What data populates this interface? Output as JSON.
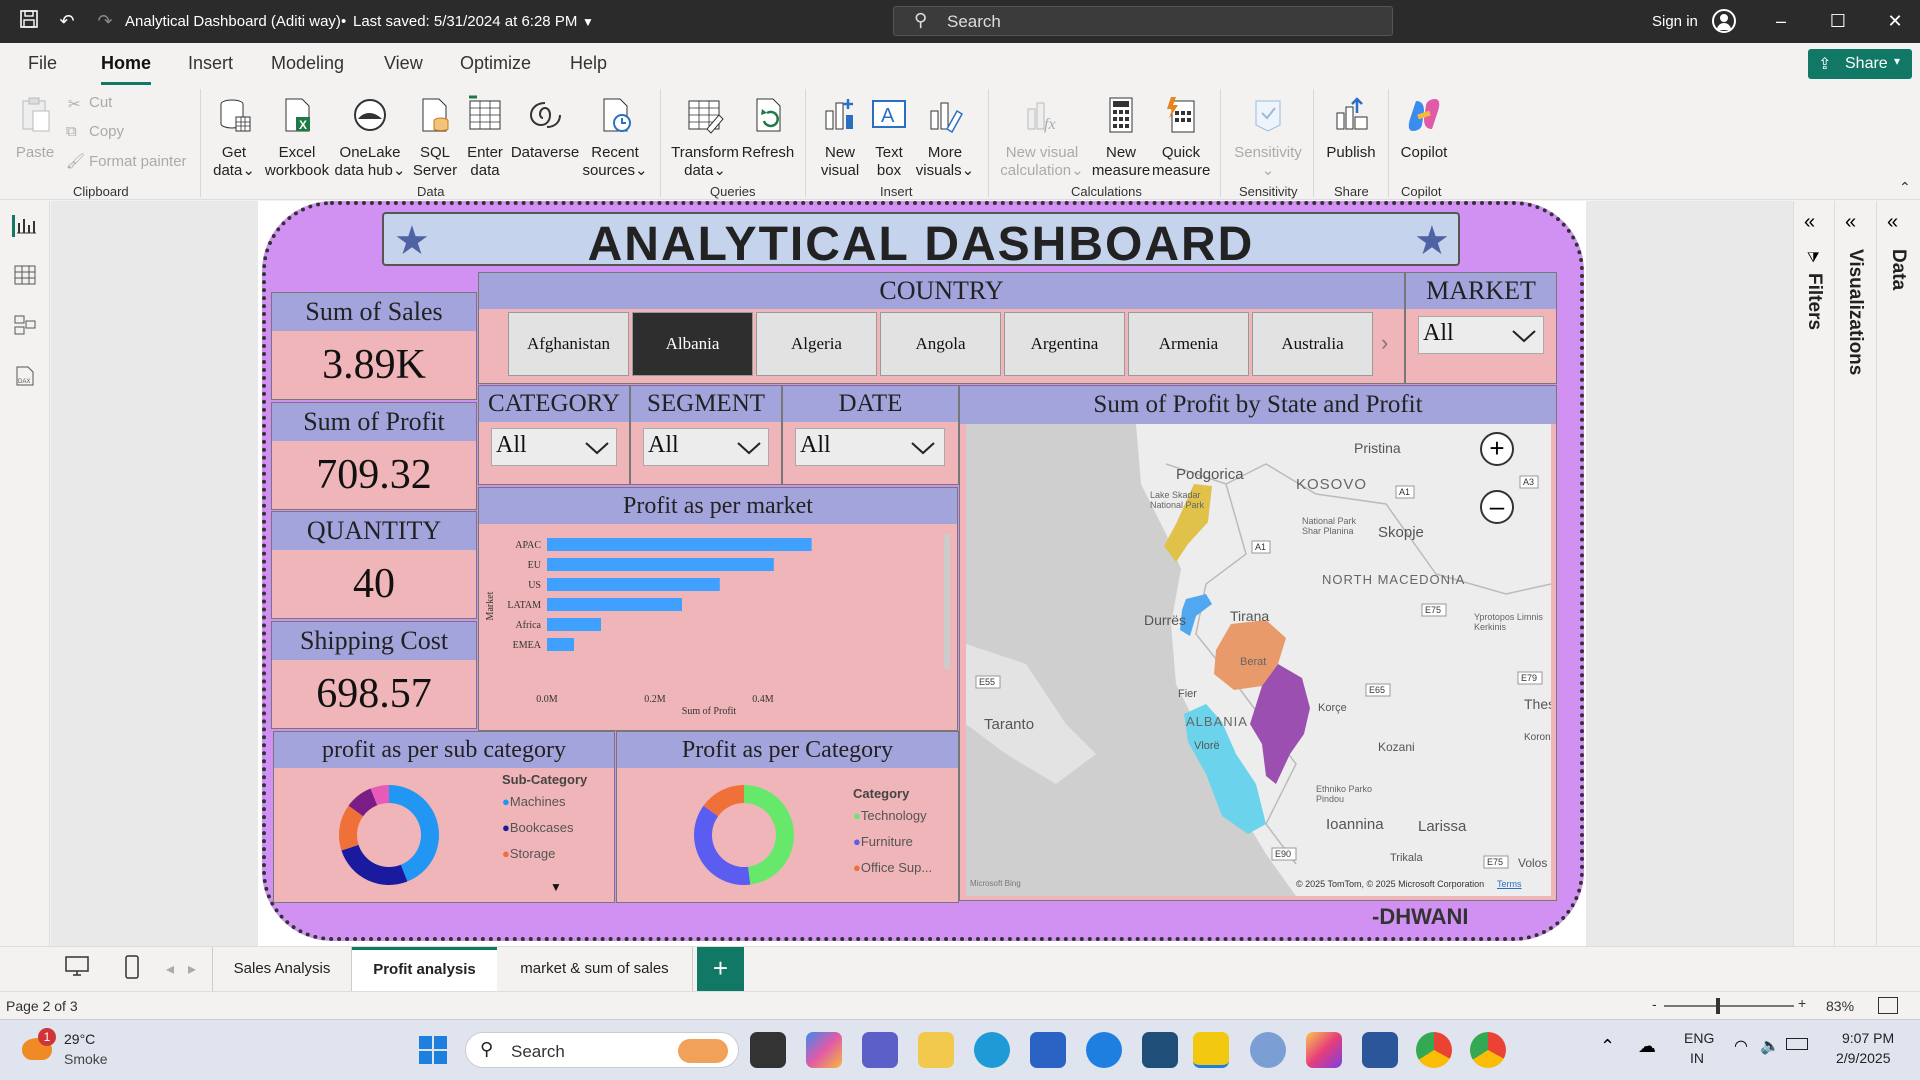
{
  "window": {
    "title": "Analytical Dashboard (Aditi way)",
    "saved_status": "Last saved: 5/31/2024 at 6:28 PM",
    "search_placeholder": "Search",
    "sign_in": "Sign in"
  },
  "ribbon_tabs": [
    "File",
    "Home",
    "Insert",
    "Modeling",
    "View",
    "Optimize",
    "Help"
  ],
  "active_tab": "Home",
  "share_label": "Share",
  "ribbon": {
    "clipboard": {
      "paste": "Paste",
      "cut": "Cut",
      "copy": "Copy",
      "format_painter": "Format painter",
      "group": "Clipboard"
    },
    "data": {
      "get_data": [
        "Get",
        "data"
      ],
      "excel": [
        "Excel",
        "workbook"
      ],
      "onelake": [
        "OneLake",
        "data hub"
      ],
      "sql": [
        "SQL",
        "Server"
      ],
      "enter": [
        "Enter",
        "data"
      ],
      "dataverse": "Dataverse",
      "recent": [
        "Recent",
        "sources"
      ],
      "group": "Data"
    },
    "queries": {
      "transform": [
        "Transform",
        "data"
      ],
      "refresh": "Refresh",
      "group": "Queries"
    },
    "insert": {
      "new_visual": [
        "New",
        "visual"
      ],
      "text_box": [
        "Text",
        "box"
      ],
      "more_visuals": [
        "More",
        "visuals"
      ],
      "group": "Insert"
    },
    "calculations": {
      "new_visual_calc": [
        "New visual",
        "calculation"
      ],
      "new_measure": [
        "New",
        "measure"
      ],
      "quick_measure": [
        "Quick",
        "measure"
      ],
      "group": "Calculations"
    },
    "sensitivity": {
      "label": "Sensitivity",
      "group": "Sensitivity"
    },
    "share": {
      "publish": "Publish",
      "group": "Share"
    },
    "copilot": {
      "label": "Copilot",
      "group": "Copilot"
    }
  },
  "dashboard": {
    "title": "ANALYTICAL DASHBOARD",
    "kpis": [
      {
        "label": "Sum of Sales",
        "value": "3.89K"
      },
      {
        "label": "Sum of Profit",
        "value": "709.32"
      },
      {
        "label": "QUANTITY",
        "value": "40"
      },
      {
        "label": "Shipping Cost",
        "value": "698.57"
      }
    ],
    "country": {
      "label": "COUNTRY",
      "tiles": [
        "Afghanistan",
        "Albania",
        "Algeria",
        "Angola",
        "Argentina",
        "Armenia",
        "Australia"
      ],
      "selected": "Albania"
    },
    "market": {
      "label": "MARKET",
      "value": "All"
    },
    "category": {
      "label": "CATEGORY",
      "value": "All"
    },
    "segment": {
      "label": "SEGMENT",
      "value": "All"
    },
    "date": {
      "label": "DATE",
      "value": "All"
    },
    "map": {
      "title": "Sum of Profit by State and Profit",
      "places": [
        "Podgorica",
        "KOSOVO",
        "Pristina",
        "Skopje",
        "NORTH MACEDONIA",
        "Durrës",
        "Tirana",
        "ALBANIA",
        "Berat",
        "Korçe",
        "Vlorë",
        "Fier",
        "Taranto",
        "Kozani",
        "Ioannina",
        "Larissa",
        "Trikala",
        "Thes",
        "Volos",
        "Koron",
        "Lake Skadar National Park",
        "National Park Shar Planina",
        "Yprotopos Limnis Kerkinis",
        "Ethniko Parko Pindou"
      ],
      "roads": [
        "A1",
        "A1",
        "A3",
        "E75",
        "E65",
        "E55",
        "E79",
        "E90",
        "E75"
      ],
      "credit": "© 2025 TomTom, © 2025 Microsoft Corporation",
      "terms": "Terms",
      "bing": "Microsoft Bing"
    },
    "signature": "-DHWANI"
  },
  "chart_data": [
    {
      "type": "bar",
      "title": "Profit as per market",
      "categories": [
        "APAC",
        "EU",
        "US",
        "LATAM",
        "Africa",
        "EMEA"
      ],
      "values": [
        0.49,
        0.42,
        0.32,
        0.25,
        0.1,
        0.05
      ],
      "unit": "M",
      "xlabel": "Sum of Profit",
      "ylabel": "Market",
      "xticks": [
        "0.0M",
        "0.2M",
        "0.4M"
      ],
      "xlim": [
        0,
        0.55
      ],
      "color": "#3fa0ff"
    },
    {
      "type": "pie",
      "title": "profit as per sub category",
      "legend_title": "Sub-Category",
      "legend": [
        {
          "name": "Machines",
          "color": "#2196f3"
        },
        {
          "name": "Bookcases",
          "color": "#1a1a9e"
        },
        {
          "name": "Storage",
          "color": "#f0703a"
        }
      ],
      "slices": [
        {
          "name": "Machines",
          "value": 44,
          "color": "#2196f3"
        },
        {
          "name": "Bookcases",
          "value": 26,
          "color": "#1a1a9e"
        },
        {
          "name": "Storage",
          "value": 15,
          "color": "#f0703a"
        },
        {
          "name": "",
          "value": 9,
          "color": "#7a1e86"
        },
        {
          "name": "",
          "value": 6,
          "color": "#e85ab8"
        }
      ]
    },
    {
      "type": "pie",
      "title": "Profit as per Category",
      "legend_title": "Category",
      "legend": [
        {
          "name": "Technology",
          "color": "#66e86a"
        },
        {
          "name": "Furniture",
          "color": "#5b5df0"
        },
        {
          "name": "Office Sup...",
          "color": "#f0703a"
        }
      ],
      "slices": [
        {
          "name": "Technology",
          "value": 48,
          "color": "#66e86a"
        },
        {
          "name": "Furniture",
          "value": 37,
          "color": "#5b5df0"
        },
        {
          "name": "Office Sup...",
          "value": 15,
          "color": "#f0703a"
        }
      ]
    }
  ],
  "panes": {
    "filters": "Filters",
    "visualizations": "Visualizations",
    "data": "Data"
  },
  "page_tabs": [
    "Sales Analysis",
    "Profit analysis",
    "market & sum of sales"
  ],
  "active_page": "Profit analysis",
  "status": {
    "page": "Page 2 of 3",
    "zoom": "83%"
  },
  "taskbar": {
    "weather_temp": "29°C",
    "weather_desc": "Smoke",
    "weather_badge": "1",
    "search": "Search",
    "lang": "ENG",
    "region": "IN",
    "time": "9:07 PM",
    "date": "2/9/2025"
  }
}
